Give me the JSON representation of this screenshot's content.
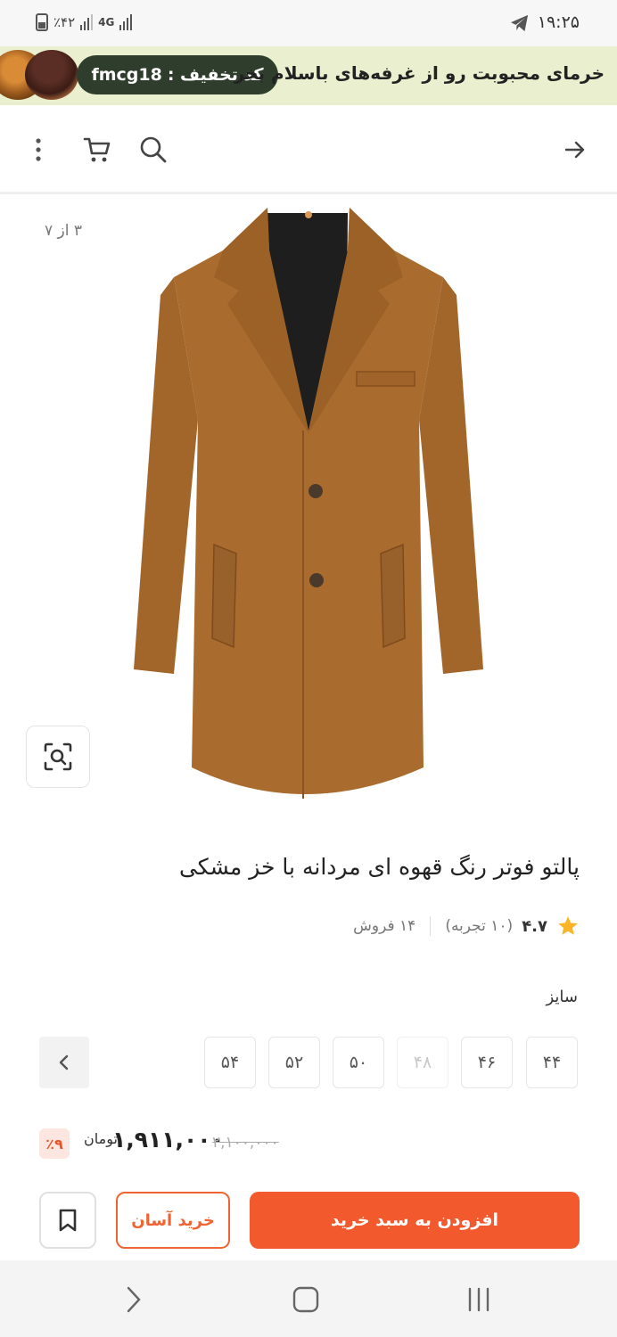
{
  "status_bar": {
    "time": "۱۹:۲۵",
    "battery": "٪۴۲",
    "network": "4G"
  },
  "promo": {
    "text": "خرمای محبوبت رو از غرفه‌های باسلام بخر",
    "code_label": "کد تخفیف :",
    "code": "fmcg18"
  },
  "nav": {
    "back": "arrow-right-icon",
    "search": "search-icon",
    "cart": "cart-icon",
    "more": "more-vertical-icon"
  },
  "gallery": {
    "counter": "۳ از ۷",
    "colors": {
      "coat": "#a86a2f",
      "lining": "#1f1f1f"
    }
  },
  "product": {
    "title": "پالتو فوتر رنگ قهوه ای مردانه با خز مشکی",
    "rating": "۴.۷",
    "reviews": "(۱۰ تجربه)",
    "sales": "۱۴ فروش"
  },
  "sizes": {
    "label": "سایز",
    "options": [
      "۴۴",
      "۴۶",
      "۴۸",
      "۵۰",
      "۵۲",
      "۵۴"
    ],
    "disabled": [
      "۴۸"
    ]
  },
  "price": {
    "discount": "٪۹",
    "final": "۱,۹۱۱,۰۰۰",
    "currency": "تومان",
    "old": "۲,۱۰۰,۰۰۰"
  },
  "actions": {
    "add_to_cart": "افزودن به سبد خرید",
    "easy_buy": "خرید آسان"
  },
  "colors": {
    "accent": "#f2592d",
    "promo_bg": "#eaf0cf",
    "promo_code_bg": "#2f3d2c",
    "star": "#f9b526"
  }
}
